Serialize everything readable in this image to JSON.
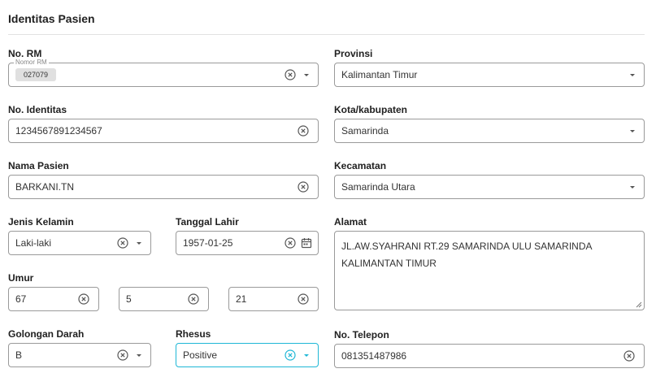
{
  "section": {
    "title": "Identitas Pasien"
  },
  "left": {
    "no_rm": {
      "label": "No. RM",
      "legend": "Nomor RM",
      "value": "027079"
    },
    "no_identitas": {
      "label": "No. Identitas",
      "value": "1234567891234567"
    },
    "nama_pasien": {
      "label": "Nama Pasien",
      "value": "BARKANI.TN"
    },
    "jenis_kelamin": {
      "label": "Jenis Kelamin",
      "value": "Laki-laki"
    },
    "tanggal_lahir": {
      "label": "Tanggal Lahir",
      "value": "1957-01-25"
    },
    "umur": {
      "label": "Umur",
      "tahun": "67",
      "bulan": "5",
      "hari": "21"
    },
    "golongan_darah": {
      "label": "Golongan Darah",
      "value": "B"
    },
    "rhesus": {
      "label": "Rhesus",
      "value": "Positive"
    }
  },
  "right": {
    "provinsi": {
      "label": "Provinsi",
      "value": "Kalimantan Timur"
    },
    "kota": {
      "label": "Kota/kabupaten",
      "value": "Samarinda"
    },
    "kecamatan": {
      "label": "Kecamatan",
      "value": "Samarinda Utara"
    },
    "alamat": {
      "label": "Alamat",
      "value": "JL.AW.SYAHRANI RT.29 SAMARINDA ULU SAMARINDA KALIMANTAN TIMUR"
    },
    "telepon": {
      "label": "No. Telepon",
      "value": "081351487986"
    }
  },
  "colors": {
    "accent": "#1fb7d6",
    "border": "#9a9a9a",
    "icon": "#555555"
  },
  "icons": [
    "clear-icon",
    "chevron-down-icon",
    "calendar-icon",
    "resize-handle-icon"
  ]
}
